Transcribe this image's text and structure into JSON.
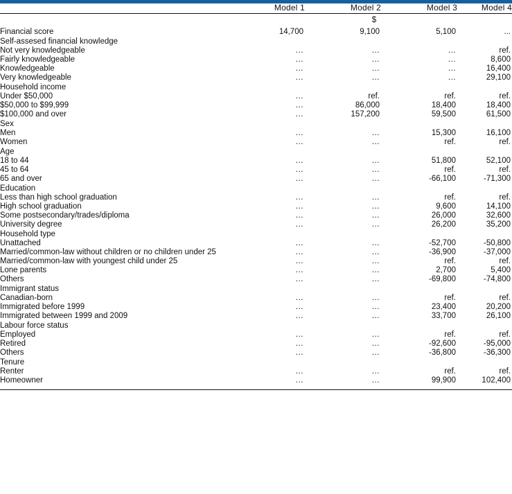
{
  "accent_color": "#15609e",
  "rule_color": "#111111",
  "header": {
    "row_label_header": "",
    "columns": [
      "Model 1",
      "Model 2",
      "Model 3",
      "Model 4"
    ]
  },
  "unit_row": {
    "unit_symbol": "$"
  },
  "total_row": {
    "label": "Financial score",
    "values": [
      "14,700",
      "9,100",
      "5,100",
      "..."
    ]
  },
  "groups": [
    {
      "title": "Self-assesed financial knowledge",
      "rows": [
        {
          "label": "Not very knowledgeable",
          "values": [
            "...",
            "...",
            "...",
            "ref."
          ]
        },
        {
          "label": "Fairly knowledgeable",
          "values": [
            "...",
            "...",
            "...",
            "8,600"
          ]
        },
        {
          "label": "Knowledgeable",
          "values": [
            "...",
            "...",
            "...",
            "16,400"
          ]
        },
        {
          "label": "Very knowledgeable",
          "values": [
            "...",
            "...",
            "...",
            "29,100"
          ]
        }
      ]
    },
    {
      "title": "Household income",
      "rows": [
        {
          "label": "Under $50,000",
          "values": [
            "...",
            "ref.",
            "ref.",
            "ref."
          ]
        },
        {
          "label": "$50,000 to $99,999",
          "values": [
            "...",
            "86,000",
            "18,400",
            "18,400"
          ]
        },
        {
          "label": "$100,000 and over",
          "values": [
            "...",
            "157,200",
            "59,500",
            "61,500"
          ]
        }
      ]
    },
    {
      "title": "Sex",
      "rows": [
        {
          "label": "Men",
          "values": [
            "...",
            "...",
            "15,300",
            "16,100"
          ]
        },
        {
          "label": "Women",
          "values": [
            "...",
            "...",
            "ref.",
            "ref."
          ]
        }
      ]
    },
    {
      "title": "Age",
      "rows": [
        {
          "label": "18 to 44",
          "values": [
            "...",
            "...",
            "51,800",
            "52,100"
          ]
        },
        {
          "label": "45 to 64",
          "values": [
            "...",
            "...",
            "ref.",
            "ref."
          ]
        },
        {
          "label": "65 and over",
          "values": [
            "...",
            "...",
            "-66,100",
            "-71,300"
          ]
        }
      ]
    },
    {
      "title": "Education",
      "rows": [
        {
          "label": "Less than high school graduation",
          "values": [
            "...",
            "...",
            "ref.",
            "ref."
          ]
        },
        {
          "label": "High school graduation",
          "values": [
            "...",
            "...",
            "9,600",
            "14,100"
          ]
        },
        {
          "label": "Some postsecondary/trades/diploma",
          "values": [
            "...",
            "...",
            "26,000",
            "32,600"
          ]
        },
        {
          "label": "University degree",
          "values": [
            "...",
            "...",
            "26,200",
            "35,200"
          ]
        }
      ]
    },
    {
      "title": "Household type",
      "rows": [
        {
          "label": "Unattached",
          "values": [
            "...",
            "...",
            "-52,700",
            "-50,800"
          ]
        },
        {
          "label": "Married/common-law without children or no children under 25",
          "values": [
            "...",
            "...",
            "-36,900",
            "-37,000"
          ]
        },
        {
          "label": "Married/common-law with youngest child under 25",
          "values": [
            "...",
            "...",
            "ref.",
            "ref."
          ]
        },
        {
          "label": "Lone parents",
          "values": [
            "...",
            "...",
            "2,700",
            "5,400"
          ]
        },
        {
          "label": "Others",
          "values": [
            "...",
            "...",
            "-69,800",
            "-74,800"
          ]
        }
      ]
    },
    {
      "title": "Immigrant status",
      "rows": [
        {
          "label": "Canadian-born",
          "values": [
            "...",
            "...",
            "ref.",
            "ref."
          ]
        },
        {
          "label": "Immigrated before 1999",
          "values": [
            "...",
            "...",
            "23,400",
            "20,200"
          ]
        },
        {
          "label": "Immigrated between 1999 and 2009",
          "values": [
            "...",
            "...",
            "33,700",
            "26,100"
          ]
        }
      ]
    },
    {
      "title": "Labour force status",
      "rows": [
        {
          "label": "Employed",
          "values": [
            "...",
            "...",
            "ref.",
            "ref."
          ]
        },
        {
          "label": "Retired",
          "values": [
            "...",
            "...",
            "-92,600",
            "-95,000"
          ]
        },
        {
          "label": "Others",
          "values": [
            "...",
            "...",
            "-36,800",
            "-36,300"
          ]
        }
      ]
    },
    {
      "title": "Tenure",
      "rows": [
        {
          "label": "Renter",
          "values": [
            "...",
            "...",
            "ref.",
            "ref."
          ]
        },
        {
          "label": "Homeowner",
          "values": [
            "...",
            "...",
            "99,900",
            "102,400"
          ]
        }
      ]
    }
  ]
}
